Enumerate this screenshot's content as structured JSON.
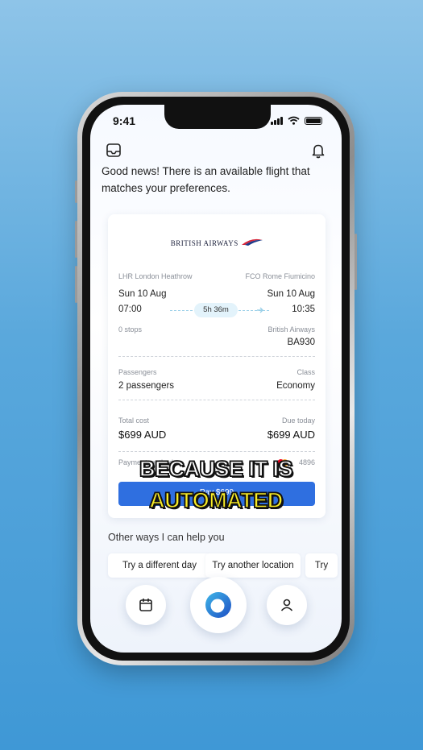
{
  "status_bar": {
    "time": "9:41"
  },
  "message": "Good news! There is an available flight that matches your preferences.",
  "flight_card": {
    "airline_logo_text": "BRITISH AIRWAYS",
    "origin": "LHR London Heathrow",
    "destination": "FCO Rome Fiumicino",
    "depart_date": "Sun 10 Aug",
    "arrive_date": "Sun 10 Aug",
    "depart_time": "07:00",
    "arrive_time": "10:35",
    "duration": "5h 36m",
    "stops": "0 stops",
    "airline": "British Airways",
    "flight_number": "BA930",
    "passengers_label": "Passengers",
    "passengers_value": "2 passengers",
    "class_label": "Class",
    "class_value": "Economy",
    "total_cost_label": "Total cost",
    "total_cost_value": "$699 AUD",
    "due_today_label": "Due today",
    "due_today_value": "$699 AUD",
    "payment_method_label": "Payment method",
    "card_last_digits": "4896",
    "pay_button_label": "Pay $699"
  },
  "caption": {
    "line1": "BECAUSE IT IS",
    "line2": "AUTOMATED"
  },
  "other_ways": {
    "heading": "Other ways I can help you",
    "chips": [
      "Try a different day",
      "Try another location",
      "Try"
    ]
  },
  "colors": {
    "accent": "#2f6fe0",
    "caption_white": "#ffffff",
    "caption_yellow": "#f8ec25",
    "duration_pill": "#e3f3fb"
  },
  "icons": {
    "top_left": "inbox-icon",
    "top_right": "bell-icon",
    "nav_left": "calendar-icon",
    "nav_center": "assistant-orb-icon",
    "nav_right": "profile-icon"
  }
}
